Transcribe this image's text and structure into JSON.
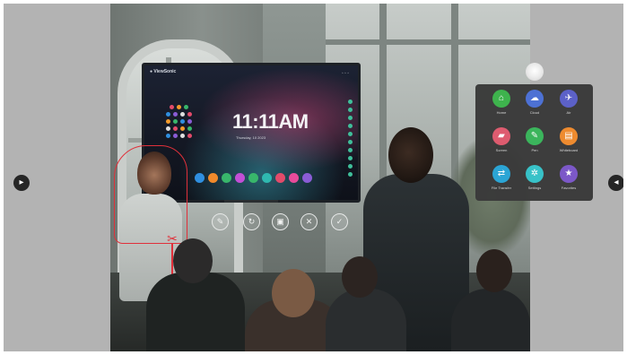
{
  "tv": {
    "brand": "● ViewSonic",
    "top_icons": "◦ ◦ ◦",
    "clock": "11:11AM",
    "date": "Thursday, 10 2023",
    "grid_dot_colors": [
      "#e34b6a",
      "#f39a2b",
      "#38b66b",
      "#2f8fe0",
      "#8a5cd6",
      "#e0e0e0"
    ],
    "dock_app_colors": [
      "#2f8fe0",
      "#f08a2b",
      "#38b66b",
      "#c24fd6",
      "#38b66b",
      "#2fb8b0",
      "#e34b6a",
      "#e84b9a",
      "#8a5cd6"
    ]
  },
  "photo_toolbar": [
    {
      "name": "edit-photo-button",
      "icon": "✎"
    },
    {
      "name": "rotate-button",
      "icon": "↻"
    },
    {
      "name": "crop-button",
      "icon": "▣"
    },
    {
      "name": "close-button",
      "icon": "✕"
    },
    {
      "name": "confirm-button",
      "icon": "✓"
    }
  ],
  "scissor_icon": "✂",
  "nav": {
    "prev_icon": "▸",
    "next_icon": "◂"
  },
  "launcher": {
    "apps": [
      {
        "label": "Home",
        "icon": "⌂",
        "color": "#3bb34a"
      },
      {
        "label": "Cloud",
        "icon": "☁",
        "color": "#4a6fd6"
      },
      {
        "label": "Air",
        "icon": "✈",
        "color": "#5a5fc9"
      },
      {
        "label": "Screen",
        "icon": "▰",
        "color": "#e05a6e"
      },
      {
        "label": "Pen",
        "icon": "✎",
        "color": "#38b65a"
      },
      {
        "label": "Whiteboard",
        "icon": "▤",
        "color": "#f08a2b"
      },
      {
        "label": "File Transfer",
        "icon": "⇄",
        "color": "#2aa7d9"
      },
      {
        "label": "Settings",
        "icon": "✲",
        "color": "#35c3c9"
      },
      {
        "label": "Favorites",
        "icon": "★",
        "color": "#7b56c9"
      }
    ]
  }
}
